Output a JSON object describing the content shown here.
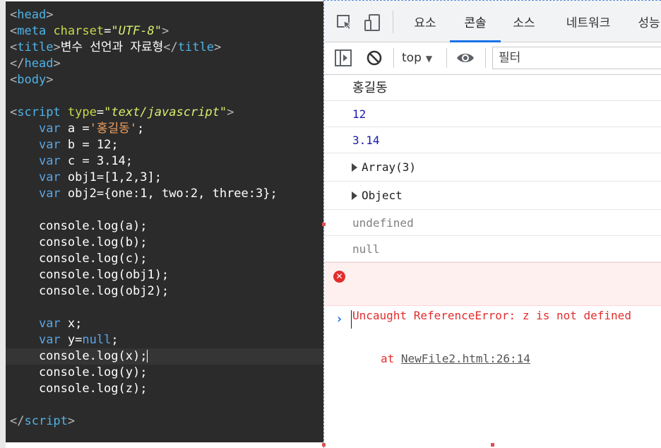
{
  "editor": {
    "lines": [
      {
        "id": "l1",
        "tokens": [
          [
            "t-bracket",
            "<"
          ],
          [
            "t-tag",
            "head"
          ],
          [
            "t-bracket",
            ">"
          ]
        ]
      },
      {
        "id": "l2",
        "tokens": [
          [
            "t-bracket",
            "<"
          ],
          [
            "t-tag",
            "meta "
          ],
          [
            "t-attr",
            "charset"
          ],
          [
            "",
            "="
          ],
          [
            "t-str",
            "\"UTF-8\""
          ],
          [
            "t-bracket",
            ">"
          ]
        ]
      },
      {
        "id": "l3",
        "tokens": [
          [
            "t-bracket",
            "<"
          ],
          [
            "t-tag",
            "title"
          ],
          [
            "t-bracket",
            ">"
          ],
          [
            "",
            "변수 선언과 자료형"
          ],
          [
            "t-bracket",
            "</"
          ],
          [
            "t-tag",
            "title"
          ],
          [
            "t-bracket",
            ">"
          ]
        ]
      },
      {
        "id": "l4",
        "tokens": [
          [
            "t-bracket",
            "</"
          ],
          [
            "t-tag",
            "head"
          ],
          [
            "t-bracket",
            ">"
          ]
        ]
      },
      {
        "id": "l5",
        "tokens": [
          [
            "t-bracket",
            "<"
          ],
          [
            "t-tag",
            "body"
          ],
          [
            "t-bracket",
            ">"
          ]
        ]
      },
      {
        "id": "l6",
        "tokens": []
      },
      {
        "id": "l7",
        "tokens": [
          [
            "t-bracket",
            "<"
          ],
          [
            "t-tag",
            "script "
          ],
          [
            "t-attr",
            "type"
          ],
          [
            "",
            "="
          ],
          [
            "t-str",
            "\"text/javascript\""
          ],
          [
            "t-bracket",
            ">"
          ]
        ]
      },
      {
        "id": "l8",
        "tokens": [
          [
            "",
            "    "
          ],
          [
            "t-kw",
            "var"
          ],
          [
            "",
            " a ="
          ],
          [
            "t-strk",
            "'홍길동'"
          ],
          [
            "",
            ";"
          ]
        ]
      },
      {
        "id": "l9",
        "tokens": [
          [
            "",
            "    "
          ],
          [
            "t-kw",
            "var"
          ],
          [
            "",
            " b = 12;"
          ]
        ]
      },
      {
        "id": "l10",
        "tokens": [
          [
            "",
            "    "
          ],
          [
            "t-kw",
            "var"
          ],
          [
            "",
            " c = 3.14;"
          ]
        ]
      },
      {
        "id": "l11",
        "tokens": [
          [
            "",
            "    "
          ],
          [
            "t-kw",
            "var"
          ],
          [
            "",
            " obj1=[1,2,3];"
          ]
        ]
      },
      {
        "id": "l12",
        "tokens": [
          [
            "",
            "    "
          ],
          [
            "t-kw",
            "var"
          ],
          [
            "",
            " obj2={one:1, two:2, three:3};"
          ]
        ]
      },
      {
        "id": "l13",
        "tokens": []
      },
      {
        "id": "l14",
        "tokens": [
          [
            "",
            "    console.log(a);"
          ]
        ]
      },
      {
        "id": "l15",
        "tokens": [
          [
            "",
            "    console.log(b);"
          ]
        ]
      },
      {
        "id": "l16",
        "tokens": [
          [
            "",
            "    console.log(c);"
          ]
        ]
      },
      {
        "id": "l17",
        "tokens": [
          [
            "",
            "    console.log(obj1);"
          ]
        ]
      },
      {
        "id": "l18",
        "tokens": [
          [
            "",
            "    console.log(obj2);"
          ]
        ]
      },
      {
        "id": "l19",
        "tokens": []
      },
      {
        "id": "l20",
        "tokens": [
          [
            "",
            "    "
          ],
          [
            "t-kw",
            "var"
          ],
          [
            "",
            " x;"
          ]
        ]
      },
      {
        "id": "l21",
        "tokens": [
          [
            "",
            "    "
          ],
          [
            "t-kw",
            "var"
          ],
          [
            "",
            " y="
          ],
          [
            "t-null",
            "null"
          ],
          [
            "",
            ";"
          ]
        ]
      },
      {
        "id": "l22",
        "tokens": [
          [
            "",
            "    console.log(x);"
          ]
        ],
        "current": true
      },
      {
        "id": "l23",
        "tokens": [
          [
            "",
            "    console.log(y);"
          ]
        ]
      },
      {
        "id": "l24",
        "tokens": [
          [
            "",
            "    console.log(z);"
          ]
        ]
      },
      {
        "id": "l25",
        "tokens": []
      },
      {
        "id": "l26",
        "tokens": [
          [
            "t-bracket",
            "</"
          ],
          [
            "t-tag",
            "script"
          ],
          [
            "t-bracket",
            ">"
          ]
        ]
      }
    ]
  },
  "devtools": {
    "tabs": [
      {
        "label": "요소",
        "active": false
      },
      {
        "label": "콘솔",
        "active": true
      },
      {
        "label": "소스",
        "active": false
      },
      {
        "label": "네트워크",
        "active": false
      },
      {
        "label": "성능",
        "active": false
      }
    ],
    "toolbar": {
      "context": "top",
      "filter_placeholder": "필터"
    },
    "console": {
      "messages": [
        {
          "kind": "text",
          "text": "홍길동"
        },
        {
          "kind": "num",
          "text": "12"
        },
        {
          "kind": "num",
          "text": "3.14"
        },
        {
          "kind": "obj",
          "text": "Array(3)"
        },
        {
          "kind": "obj",
          "text": "Object"
        },
        {
          "kind": "undef",
          "text": "undefined"
        },
        {
          "kind": "undef",
          "text": "null"
        }
      ],
      "error": {
        "icon": "x-icon",
        "message": "Uncaught ReferenceError: z is not defined",
        "at_label": "at ",
        "link": "NewFile2.html:26:14"
      },
      "prompt_symbol": "›"
    },
    "icons": [
      "inspect-element-icon",
      "device-toggle-icon",
      "sidebar-toggle-icon",
      "clear-console-icon",
      "eye-icon"
    ],
    "colors": {
      "accent": "#1a73e8",
      "error": "#e22d2d",
      "number": "#1a1aa6"
    }
  }
}
